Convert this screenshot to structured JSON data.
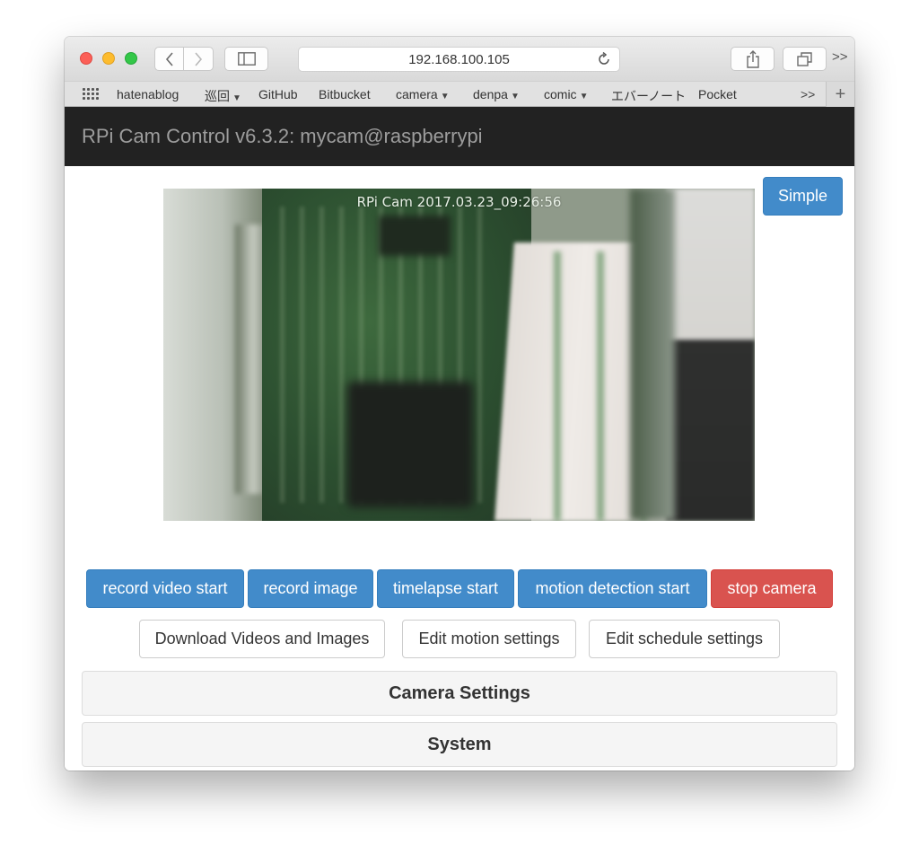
{
  "browser": {
    "url": "192.168.100.105",
    "bookmarks": [
      {
        "label": "hatenablog",
        "has_menu": false
      },
      {
        "label": "巡回",
        "has_menu": true
      },
      {
        "label": "GitHub",
        "has_menu": false
      },
      {
        "label": "Bitbucket",
        "has_menu": false
      },
      {
        "label": "camera",
        "has_menu": true
      },
      {
        "label": "denpa",
        "has_menu": true
      },
      {
        "label": "comic",
        "has_menu": true
      },
      {
        "label": "エバーノート",
        "has_menu": false
      },
      {
        "label": "Pocket",
        "has_menu": false
      }
    ],
    "overflow_label": ">>",
    "toolbar_overflow_label": ">>",
    "add_label": "+"
  },
  "navbar": {
    "title": "RPi Cam Control v6.3.2: mycam@raspberrypi"
  },
  "preview": {
    "overlay_text": "RPi Cam  2017.03.23_09:26:56"
  },
  "buttons": {
    "simple": "Simple",
    "action_row": [
      {
        "label": "record video start",
        "style": "primary"
      },
      {
        "label": "record image",
        "style": "primary"
      },
      {
        "label": "timelapse start",
        "style": "primary"
      },
      {
        "label": "motion detection start",
        "style": "primary"
      },
      {
        "label": "stop camera",
        "style": "danger"
      }
    ],
    "link_row": [
      {
        "label": "Download Videos and Images"
      },
      {
        "label": "Edit motion settings"
      },
      {
        "label": "Edit schedule settings"
      }
    ]
  },
  "panels": [
    {
      "title": "Camera Settings"
    },
    {
      "title": "System"
    }
  ],
  "colors": {
    "primary": "#428bca",
    "danger": "#d9534f",
    "navbar": "#222222",
    "navbar_text": "#9d9d9d"
  },
  "icons": {
    "back": "chevron-left-icon",
    "forward": "chevron-right-icon",
    "sidebar": "sidebar-icon",
    "reload": "reload-icon",
    "share": "share-icon",
    "tabs": "tabs-icon",
    "bookmarks_grid": "grid-icon"
  }
}
